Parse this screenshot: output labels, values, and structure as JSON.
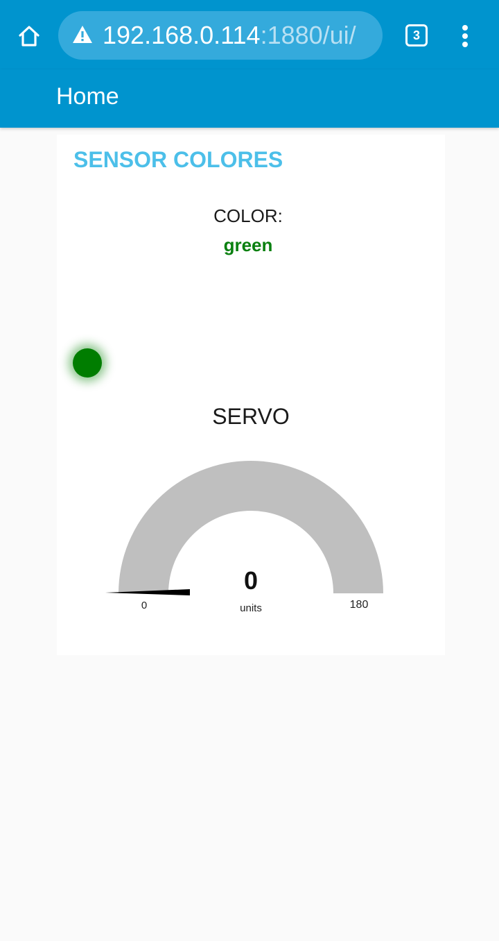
{
  "browser": {
    "url_host": "192.168.0.114",
    "url_rest": ":1880/ui/",
    "tab_count": "3"
  },
  "app": {
    "title": "Home"
  },
  "group": {
    "title": "SENSOR COLORES",
    "color_label": "COLOR:",
    "color_value": "green",
    "led_color": "#007d00"
  },
  "gauge": {
    "title": "SERVO",
    "value": "0",
    "units": "units",
    "min": "0",
    "max": "180",
    "track_color": "#bfbfbf",
    "needle_color": "#000000"
  },
  "colors": {
    "bar": "#0094ce",
    "group_title": "#4cbfe9",
    "value_green": "#0a8010"
  }
}
